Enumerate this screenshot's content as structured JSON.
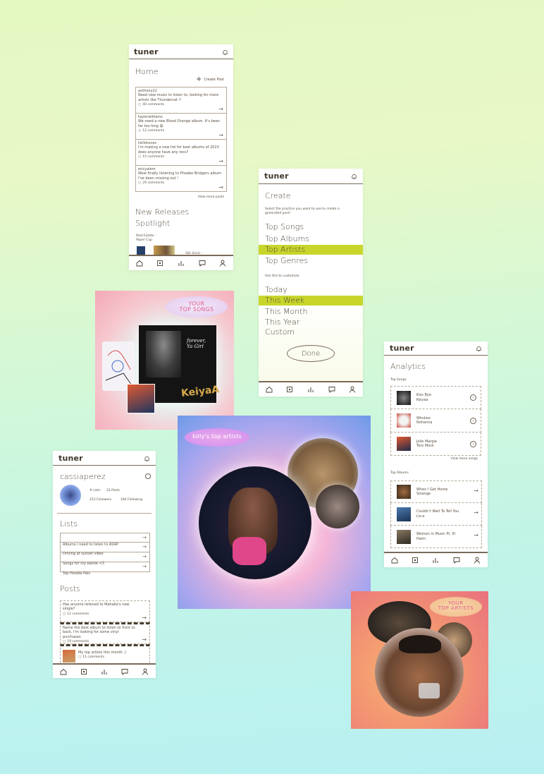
{
  "home": {
    "logo": "tuner",
    "title": "Home",
    "create_post": "Create Post",
    "posts": [
      {
        "user": "anthony22",
        "text": "Need new music to listen to, looking for more artists like Thundercat !!",
        "comments": "40 comments"
      },
      {
        "user": "taylorwilliams",
        "text": "We need a new Blood Orange album. It's been far too long 😩",
        "comments": "12 comments"
      },
      {
        "user": "hellotunes",
        "text": "I'm making a new list for best albums of 2023 does anyone have any recs?",
        "comments": "15 comments"
      },
      {
        "user": "ericyalem",
        "text": "Wow finally listening to Phoebe Bridgers album I've been missing out !",
        "comments": "29 comments"
      }
    ],
    "view_more": "View more posts",
    "new_releases": "New Releases",
    "spotlight": "Spotlight",
    "spotlight_caption": "Real Estate - Paper Cup",
    "spotlight_more": "Silk Sonic -"
  },
  "create": {
    "logo": "tuner",
    "title": "Create",
    "subtitle": "Select the practice you want to use to create a generated post!",
    "categories": [
      "Top Songs",
      "Top Albums",
      "Top Artists",
      "Top Genres"
    ],
    "timeframe_hint": "Use this to customize",
    "timeframes": [
      "Today",
      "This Week",
      "This Month",
      "This Year",
      "Custom"
    ],
    "done": "Done"
  },
  "analytics": {
    "logo": "tuner",
    "title": "Analytics",
    "songs_label": "Top Songs",
    "songs": [
      {
        "title": "Kiss Bye",
        "artist": "Keiyaa"
      },
      {
        "title": "Windsor",
        "artist": "Nohanna"
      },
      {
        "title": "Jolie Margie",
        "artist": "Toro Mock"
      }
    ],
    "view_more": "View more songs",
    "albums_label": "Top Albums",
    "albums": [
      {
        "title": "When I Get Home",
        "artist": "Solange"
      },
      {
        "title": "Couldn't Wait To Tell You",
        "artist": "Liv.e"
      },
      {
        "title": "Women in Music Pt. III",
        "artist": "Haim"
      }
    ]
  },
  "profile": {
    "logo": "tuner",
    "username": "cassiaperez",
    "stat_posts": "# Lists",
    "stat_followers": "22 Posts",
    "followers": "253 Followers",
    "following": "184 Following",
    "lists_title": "Lists",
    "lists": [
      "Albums I need to listen to ASAP",
      "Driving at sunset vibes",
      "Songs for my bestie <3",
      "Top Hoodie Pals"
    ],
    "posts_title": "Posts",
    "posts": [
      {
        "text": "Has anyone listened to Mahalia's new single?",
        "comments": "12 comments"
      },
      {
        "text": "Name the best album to listen to front to back, I'm looking for some vinyl purchases",
        "comments": "19 comments"
      },
      {
        "text": "My top artists this month :)",
        "comments": "11 comments"
      }
    ]
  },
  "cards": {
    "top_songs_label": "YOUR\nTOP SONGS",
    "album_title": "forever, Ya Girl",
    "album_artist": "KeiyaA",
    "billy_label": "billy's top artists",
    "top_artists_label": "YOUR\nTOP ARTISTS"
  },
  "icons": {
    "bell": "bell-icon",
    "nav": [
      "home-icon",
      "create-icon",
      "analytics-icon",
      "chat-icon",
      "profile-icon"
    ]
  },
  "colors": {
    "highlight": "#c8d62c",
    "brown": "#7a6a58",
    "bg_top": "#e4f8c2",
    "bg_bottom": "#b8f0f2"
  }
}
